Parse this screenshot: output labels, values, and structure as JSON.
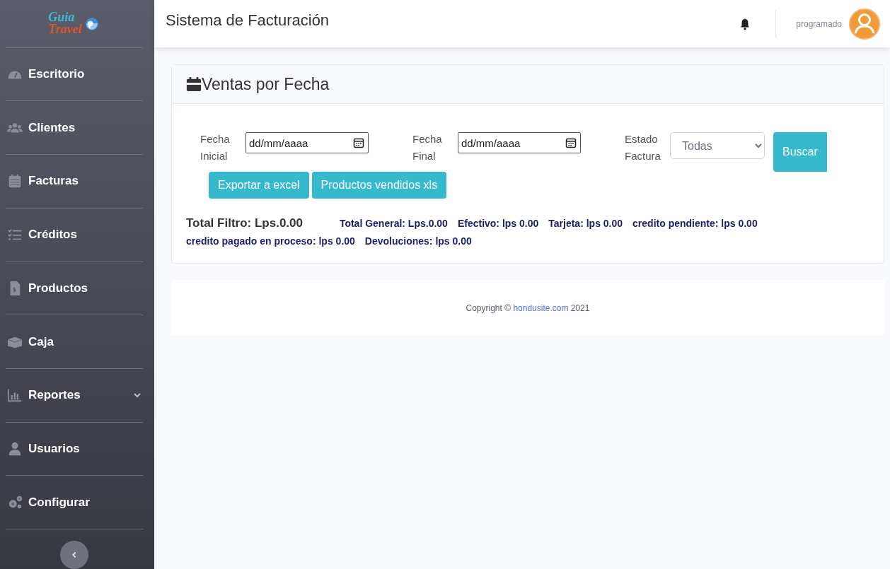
{
  "sidebar": {
    "logo": {
      "line_1": "Guia",
      "line_2": "Travel"
    },
    "items": [
      {
        "label": "Escritorio",
        "expandable": false
      },
      {
        "label": "Clientes",
        "expandable": false
      },
      {
        "label": "Facturas",
        "expandable": false
      },
      {
        "label": "Créditos",
        "expandable": false
      },
      {
        "label": "Productos",
        "expandable": false
      },
      {
        "label": "Caja",
        "expandable": false
      },
      {
        "label": "Reportes",
        "expandable": true
      },
      {
        "label": "Usuarios",
        "expandable": false
      },
      {
        "label": "Configurar",
        "expandable": false
      }
    ]
  },
  "topbar": {
    "title": "Sistema de Facturación",
    "user": "programado"
  },
  "card": {
    "title": "Ventas por Fecha",
    "filters": [
      {
        "kind": "date",
        "label": "Fecha Inicial",
        "placeholder": "dd/mm/aaaa"
      },
      {
        "kind": "date",
        "label": "Fecha Final",
        "placeholder": "dd/mm/aaaa"
      },
      {
        "kind": "select",
        "label": "Estado Factura",
        "value": "Todas"
      }
    ],
    "search_button": "Buscar",
    "buttons": [
      "Exportar a excel",
      "Productos vendidos xls"
    ],
    "total_filter": "Total Filtro: Lps.0.00",
    "totals": [
      "Total General: Lps.0.00",
      "Efectivo: lps 0.00",
      "Tarjeta: lps 0.00",
      "credito pendiente: lps 0.00",
      "credito pagado en proceso: lps 0.00",
      "Devoluciones: lps 0.00"
    ]
  },
  "footer": {
    "prefix": "Copyright ©",
    "link": "hondusite.com",
    "suffix": "2021"
  }
}
